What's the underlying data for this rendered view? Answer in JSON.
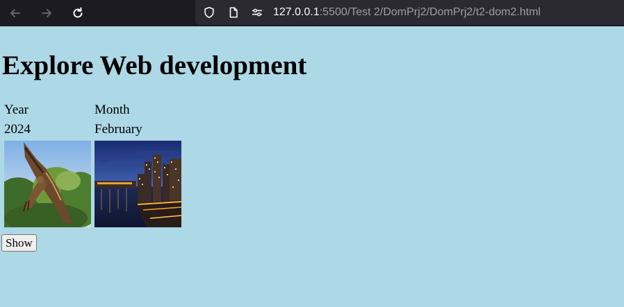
{
  "browser": {
    "url_host": "127.0.0.1",
    "url_path": ":5500/Test 2/DomPrj2/DomPrj2/t2-dom2.html"
  },
  "page": {
    "title": "Explore Web development",
    "table": {
      "headers": [
        "Year",
        "Month"
      ],
      "row": [
        "2024",
        "February"
      ]
    },
    "images": [
      "eagle-photo",
      "city-night-photo"
    ],
    "show_button_label": "Show"
  },
  "colors": {
    "page_background": "#add8e6",
    "browser_toolbar": "#1c1b22",
    "url_bar": "#2b2a33"
  }
}
